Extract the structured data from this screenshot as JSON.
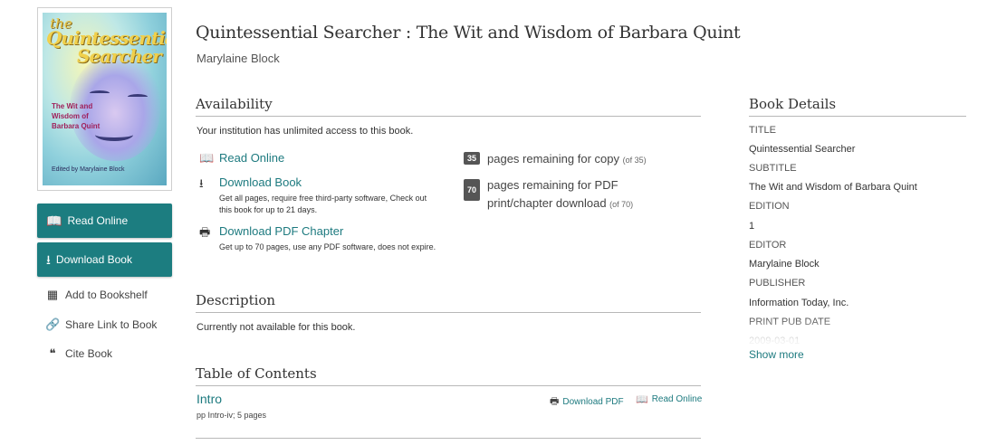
{
  "book": {
    "title": "Quintessential Searcher : The Wit and Wisdom of Barbara Quint",
    "author": "Marylaine Block",
    "cover": {
      "the": "the",
      "quint": "Quintessential",
      "searcher": "Searcher",
      "subtitle": "The Wit and Wisdom of Barbara Quint",
      "edited_by": "Edited by Marylaine Block"
    }
  },
  "sidebar": {
    "read_online": "Read Online",
    "download_book": "Download Book",
    "add_to_bookshelf": "Add to Bookshelf",
    "share_link": "Share Link to Book",
    "cite_book": "Cite Book"
  },
  "availability": {
    "heading": "Availability",
    "access_note": "Your institution has unlimited access to this book.",
    "read_online": "Read Online",
    "download_book": "Download Book",
    "download_book_desc": "Get all pages, require free third-party software, Check out this book for up to 21 days.",
    "download_pdf_chapter": "Download PDF Chapter",
    "download_pdf_desc": "Get up to 70 pages, use any PDF software, does not expire.",
    "copy_badge": "35",
    "copy_text": "pages remaining for copy",
    "copy_of": "(of 35)",
    "print_badge": "70",
    "print_text": "pages remaining for PDF print/chapter download",
    "print_of": "(of 70)"
  },
  "description": {
    "heading": "Description",
    "text": "Currently not available for this book."
  },
  "toc": {
    "heading": "Table of Contents",
    "items": [
      {
        "title": "Intro",
        "meta": "pp Intro-iv; 5 pages",
        "download_pdf": "Download PDF",
        "read_online": "Read Online"
      }
    ]
  },
  "details": {
    "heading": "Book Details",
    "rows": [
      {
        "key": "TITLE",
        "value": "Quintessential Searcher"
      },
      {
        "key": "SUBTITLE",
        "value": "The Wit and Wisdom of Barbara Quint"
      },
      {
        "key": "EDITION",
        "value": "1"
      },
      {
        "key": "EDITOR",
        "value": "Marylaine Block"
      },
      {
        "key": "PUBLISHER",
        "value": "Information Today, Inc."
      },
      {
        "key": "PRINT PUB DATE",
        "value": "2009-03-01"
      }
    ],
    "show_more": "Show more"
  },
  "colors": {
    "accent": "#1c7d80",
    "badge": "#555555"
  },
  "icons": [
    "book-icon",
    "download-icon",
    "bookshelf-add-icon",
    "link-icon",
    "quote-icon",
    "pdf-icon"
  ]
}
